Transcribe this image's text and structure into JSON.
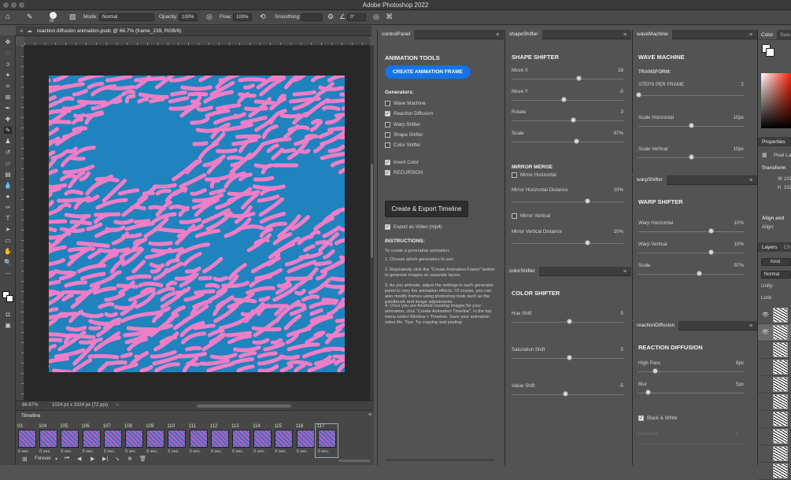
{
  "app": {
    "title": "Adobe Photoshop 2022"
  },
  "options_bar": {
    "brush_size": "90",
    "mode_label": "Mode:",
    "mode_value": "Normal",
    "opacity_label": "Opacity:",
    "opacity_value": "100%",
    "flow_label": "Flow:",
    "flow_value": "100%",
    "smoothing_label": "Smoothing:",
    "angle_value": "0°"
  },
  "document": {
    "tab_title": "reaction diffusion animation.psdc @ 66.7% (frame_239, RGB/8)",
    "zoom": "66.67%",
    "dimensions": "1024 px x 1024 px (72 ppi)",
    "colors": {
      "background": "#1f83be",
      "pattern": "#f07ec6"
    }
  },
  "timeline": {
    "title": "Timeline",
    "frames": [
      {
        "num": "03",
        "delay": "0 sec."
      },
      {
        "num": "104",
        "delay": "0 sec."
      },
      {
        "num": "105",
        "delay": "0 sec."
      },
      {
        "num": "106",
        "delay": "0 sec."
      },
      {
        "num": "107",
        "delay": "0 sec."
      },
      {
        "num": "108",
        "delay": "0 sec."
      },
      {
        "num": "109",
        "delay": "0 sec."
      },
      {
        "num": "110",
        "delay": "0 sec."
      },
      {
        "num": "111",
        "delay": "0 sec."
      },
      {
        "num": "112",
        "delay": "0 sec."
      },
      {
        "num": "113",
        "delay": "0 sec."
      },
      {
        "num": "114",
        "delay": "0 sec."
      },
      {
        "num": "115",
        "delay": "0 sec."
      },
      {
        "num": "116",
        "delay": "0 sec."
      },
      {
        "num": "117",
        "delay": "0 sec."
      }
    ],
    "loop": "Forever"
  },
  "control_panel": {
    "tab": "controlPanel",
    "title": "ANIMATION TOOLS",
    "create_frame_button": "CREATE ANIMATION FRAME",
    "generators_label": "Generators:",
    "generators": [
      {
        "label": "Wave Machine",
        "checked": false
      },
      {
        "label": "Reaction Diffusion",
        "checked": true
      },
      {
        "label": "Warp Shifter",
        "checked": false
      },
      {
        "label": "Shape Shifter",
        "checked": false
      },
      {
        "label": "Color Shifter",
        "checked": false
      }
    ],
    "invert_color": {
      "label": "Invert Color",
      "checked": true
    },
    "recursion": {
      "label": "RECURSION",
      "checked": true
    },
    "export_button": "Create & Export Timeline",
    "export_video": {
      "label": "Export as Video (mp4)",
      "checked": true
    },
    "instructions_title": "INSTRUCTIONS:",
    "instructions": [
      "To create a generative animation:",
      "1. Choose which generators to use:",
      "2. Repeatedly click the \"Create Animation Frame\" button to generate images on separate layers.",
      "3. As you animate, adjust the settings in each generator panel to vary the animation effects. Of course, you can also modify frames using photoshop tools such as the paintbrush and image adjustments.",
      "4. Once you are finished creating images for your animation, click \"Create Animation Timeline\". In the top menu select Window > Timeline. Save your animation video file. Tips: Try copying and pasting"
    ]
  },
  "shape_shifter": {
    "tab": "shapeShifter",
    "title": "SHAPE SHIFTER",
    "sliders": [
      {
        "label": "Move X",
        "value": "18",
        "level": 0.6
      },
      {
        "label": "Move Y",
        "value": "-5",
        "level": 0.47
      },
      {
        "label": "Rotate",
        "value": "3",
        "level": 0.55
      },
      {
        "label": "Scale",
        "value": "97%",
        "level": 0.58
      }
    ],
    "mirror_title": "MIRROR MERGE",
    "mirror_horizontal": {
      "label": "Mirror Horizontal",
      "checked": false
    },
    "mirror_h_distance": {
      "label": "Mirror Horizontal Distance",
      "value": "10%",
      "level": 0.68
    },
    "mirror_vertical": {
      "label": "Mirror Vertical",
      "checked": false
    },
    "mirror_v_distance": {
      "label": "Mirror Vertical Distance",
      "value": "10%",
      "level": 0.68
    }
  },
  "color_shifter": {
    "tab": "colorShifter",
    "title": "COLOR SHIFTER",
    "sliders": [
      {
        "label": "Hue Shift",
        "value": "5",
        "level": 0.52
      },
      {
        "label": "Saturation Shift",
        "value": "5",
        "level": 0.52
      },
      {
        "label": "Value Shift",
        "value": "-5",
        "level": 0.48
      }
    ]
  },
  "wave_machine": {
    "tab": "waveMachine",
    "title": "WAVE MACHINE",
    "transform_label": "TRANSFORM:",
    "steps": {
      "label": "STEPS PER FRAME",
      "value": "2",
      "level": 0.0
    },
    "sliders": [
      {
        "label": "Scale Horizontal",
        "value": "10px",
        "level": 0.5
      },
      {
        "label": "Scale Vertical",
        "value": "10px",
        "level": 0.5
      }
    ]
  },
  "warp_shifter": {
    "tab": "warpShifter",
    "title": "WARP SHIFTER",
    "sliders": [
      {
        "label": "Warp Horizontal",
        "value": "10%",
        "level": 0.69
      },
      {
        "label": "Warp Vertical",
        "value": "10%",
        "level": 0.69
      },
      {
        "label": "Scale",
        "value": "97%",
        "level": 0.58
      }
    ]
  },
  "reaction_diffusion": {
    "tab": "reactionDiffusion",
    "title": "REACTION DIFFUSION",
    "sliders": [
      {
        "label": "High Pass",
        "value": "8px",
        "level": 0.16
      },
      {
        "label": "Blur",
        "value": "5px",
        "level": 0.09
      }
    ],
    "black_white": {
      "label": "Black & White",
      "checked": true
    },
    "disabled_label": "Posterize",
    "disabled_value": "4"
  },
  "right_strip": {
    "color_tab": "Color",
    "swatches_tab": "Swa",
    "properties_tab": "Properties",
    "pixel_layer": "Pixel La",
    "transform": "Transform",
    "w_label": "W",
    "w_value": "102",
    "h_label": "H",
    "h_value": "102",
    "align": "Align and",
    "align_label": "Align:",
    "layers_tab": "Layers",
    "channels_tab": "Ch",
    "kind": "Kind",
    "blend": "Normal",
    "unify": "Unify:",
    "lock": "Lock:"
  }
}
